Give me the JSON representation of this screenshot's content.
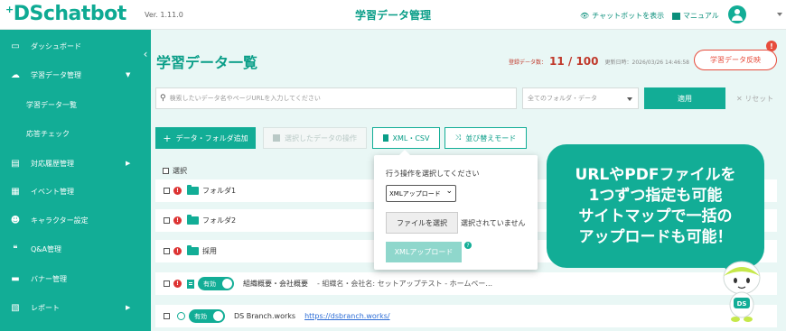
{
  "header": {
    "logo": "DSchatbot",
    "logo_plus": "+",
    "version": "Ver. 1.11.0",
    "title": "学習データ管理",
    "chatbot_link": "チャットボットを表示",
    "manual_link": "マニュアル"
  },
  "sidebar": {
    "items": [
      {
        "label": "ダッシュボード",
        "icon": "monitor-icon"
      },
      {
        "label": "学習データ管理",
        "icon": "brain-icon",
        "expanded": true
      },
      {
        "label": "学習データ一覧",
        "sub": true
      },
      {
        "label": "応答チェック",
        "sub": true
      },
      {
        "label": "対応履歴管理",
        "icon": "history-icon",
        "arrow": true
      },
      {
        "label": "イベント管理",
        "icon": "calendar-icon"
      },
      {
        "label": "キャラクター設定",
        "icon": "robot-icon"
      },
      {
        "label": "Q&A管理",
        "icon": "qa-icon"
      },
      {
        "label": "バナー管理",
        "icon": "banner-icon"
      },
      {
        "label": "レポート",
        "icon": "report-icon",
        "arrow": true
      }
    ]
  },
  "page": {
    "title": "学習データ一覧",
    "count_label": "登録データ数：",
    "count_value": "11 / 100",
    "updated": "更新日時：2026/03/26 14:46:58",
    "reflect_button": "学習データ反映",
    "alert_badge": "!"
  },
  "filters": {
    "search_placeholder": "検索したいデータ名やページURLを入力してください",
    "folder_select": "全てのフォルダ・データ",
    "apply": "適用",
    "reset": "リセット"
  },
  "actions": {
    "add": "データ・フォルダ追加",
    "bulk": "選択したデータの操作",
    "xml_csv": "XML・CSV",
    "sort_mode": "並び替えモード"
  },
  "table": {
    "select_all": "選択",
    "rows": [
      {
        "type": "folder",
        "name": "フォルダ1",
        "error": true
      },
      {
        "type": "folder",
        "name": "フォルダ2",
        "error": true
      },
      {
        "type": "folder",
        "name": "採用",
        "error": true
      },
      {
        "type": "doc",
        "error": true,
        "status": "有効",
        "name": "組織概要・会社概要",
        "desc": "- 組織名・会社名: セットアップテスト - ホームペー..."
      },
      {
        "type": "web",
        "status": "有効",
        "name": "DS Branch.works",
        "url": "https://dsbranch.works/"
      }
    ]
  },
  "popup": {
    "label": "行う操作を選択してください",
    "select_value": "XMLアップロード",
    "file_button": "ファイルを選択",
    "no_file": "選択されていません",
    "upload_button": "XMLアップロード",
    "help": "?"
  },
  "promo": {
    "lines": [
      "URLやPDFファイルを",
      "1つずつ指定も可能",
      "サイトマップで一括の",
      "アップロードも可能！"
    ],
    "mascot_badge": "DS"
  },
  "colors": {
    "accent": "#12ad96",
    "alert": "#e74c3c",
    "background": "#e9f7f5"
  }
}
